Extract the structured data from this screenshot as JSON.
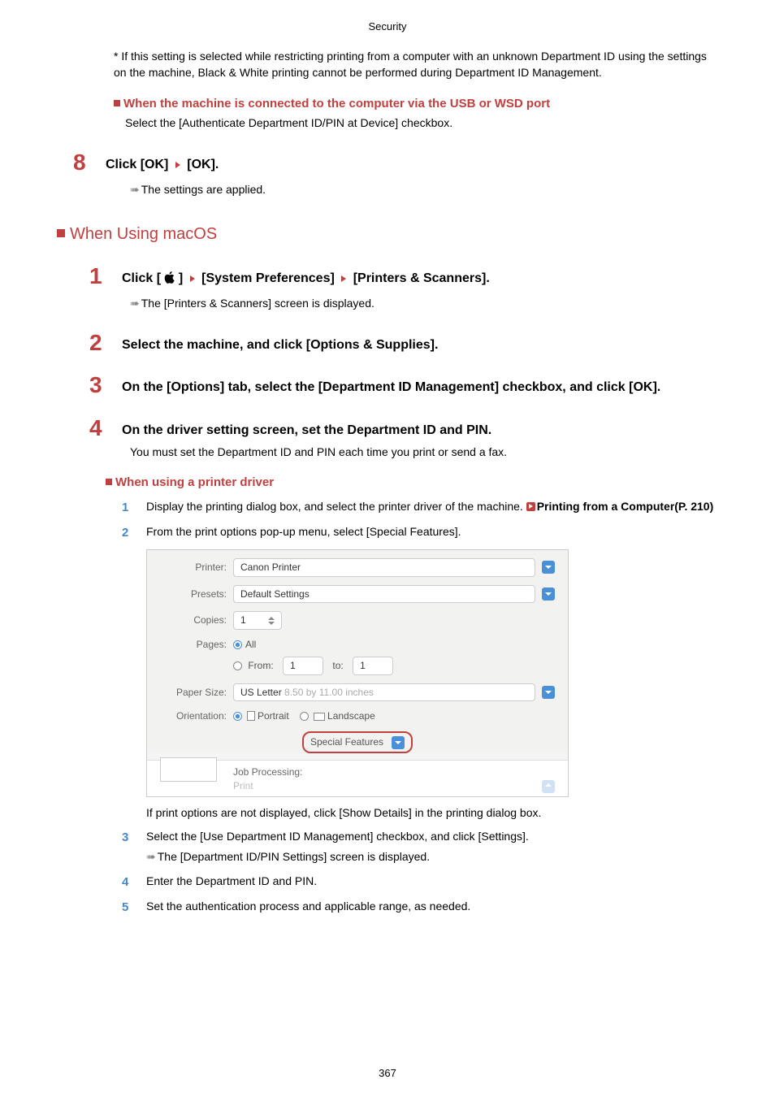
{
  "header": {
    "title": "Security"
  },
  "intro_note": "* If this setting is selected while restricting printing from a computer with an unknown Department ID using the settings on the machine, Black & White printing cannot be performed during Department ID Management.",
  "usb_heading": "When the machine is connected to the computer via the USB or WSD port",
  "usb_text": "Select the [Authenticate Department ID/PIN at Device] checkbox.",
  "step8": {
    "num": "8",
    "pre": "Click [OK]",
    "post": "[OK]."
  },
  "applied": "The settings are applied.",
  "macos_heading": "When Using macOS",
  "m_step1": {
    "num": "1",
    "a": "Click [",
    "b": "]",
    "c": "[System Preferences]",
    "d": "[Printers & Scanners]."
  },
  "m_step1_result": "The [Printers & Scanners] screen is displayed.",
  "m_step2": {
    "num": "2",
    "text": "Select the machine, and click [Options & Supplies]."
  },
  "m_step3": {
    "num": "3",
    "text": "On the [Options] tab, select the [Department ID Management] checkbox, and click [OK]."
  },
  "m_step4": {
    "num": "4",
    "text": "On the driver setting screen, set the Department ID and PIN."
  },
  "m_step4_body": "You must set the Department ID and PIN each time you print or send a fax.",
  "printer_driver_heading": "When using a printer driver",
  "sub1": {
    "num": "1",
    "text": "Display the printing dialog box, and select the printer driver of the machine. ",
    "link": "Printing from a Computer(P. 210)"
  },
  "sub2": {
    "num": "2",
    "text": "From the print options pop-up menu, select [Special Features]."
  },
  "sub2_after": "If print options are not displayed, click [Show Details] in the printing dialog box.",
  "sub3": {
    "num": "3",
    "text": "Select the [Use Department ID Management] checkbox, and click [Settings]."
  },
  "sub3_result": "The [Department ID/PIN Settings] screen is displayed.",
  "sub4": {
    "num": "4",
    "text": "Enter the Department ID and PIN."
  },
  "sub5": {
    "num": "5",
    "text": "Set the authentication process and applicable range, as needed."
  },
  "dialog": {
    "printer_label": "Printer:",
    "printer_value": "Canon Printer",
    "presets_label": "Presets:",
    "presets_value": "Default Settings",
    "copies_label": "Copies:",
    "copies_value": "1",
    "pages_label": "Pages:",
    "pages_all": "All",
    "pages_from_label": "From:",
    "pages_from": "1",
    "pages_to_label": "to:",
    "pages_to": "1",
    "paper_label": "Paper Size:",
    "paper_value": "US Letter",
    "paper_dim": "8.50 by 11.00 inches",
    "orient_label": "Orientation:",
    "orient_portrait": "Portrait",
    "orient_landscape": "Landscape",
    "special": "Special Features",
    "job_label": "Job Processing:",
    "job_value": "Print"
  },
  "page_number": "367"
}
